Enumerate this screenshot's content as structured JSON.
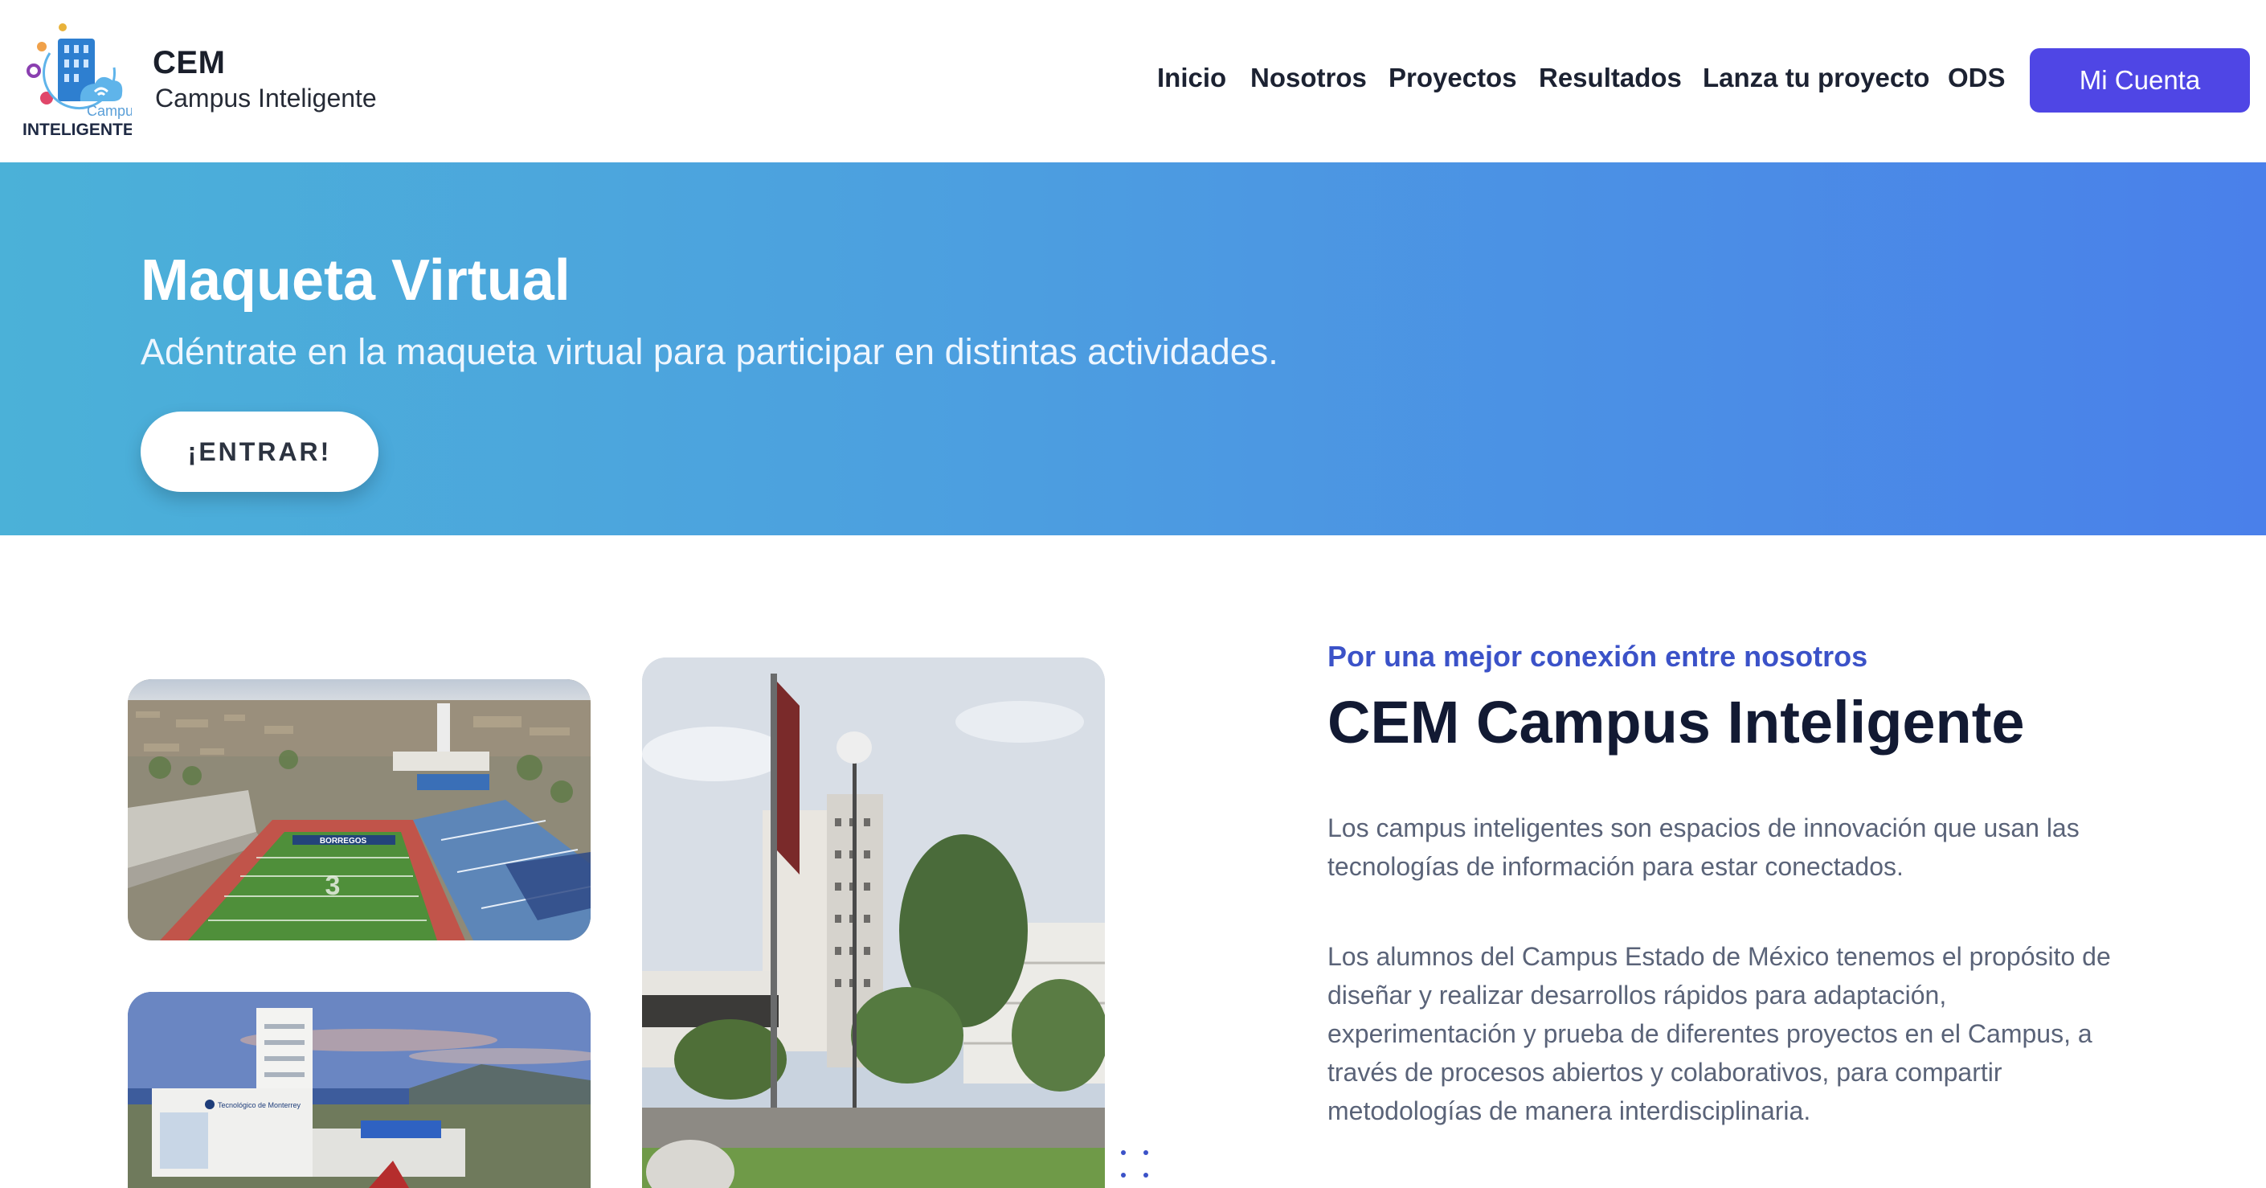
{
  "header": {
    "logo_caption_top": "Campus",
    "logo_caption_bottom": "INTELIGENTE",
    "brand_title": "CEM",
    "brand_subtitle": "Campus Inteligente",
    "nav": [
      {
        "label": "Inicio"
      },
      {
        "label": "Nosotros"
      },
      {
        "label": "Proyectos"
      },
      {
        "label": "Resultados"
      },
      {
        "label": "Lanza tu proyecto"
      },
      {
        "label": "ODS"
      }
    ],
    "account_button": "Mi Cuenta"
  },
  "hero": {
    "title": "Maqueta Virtual",
    "subtitle": "Adéntrate en la maqueta virtual para participar en distintas actividades.",
    "button": "¡ENTRAR!"
  },
  "about": {
    "eyebrow": "Por una mejor conexión entre nosotros",
    "title": "CEM Campus Inteligente",
    "paragraph1": "Los campus inteligentes son espacios de innovación que usan las tecnologías de información para estar conectados.",
    "paragraph2": "Los alumnos del Campus Estado de México tenemos el propósito de diseñar y realizar desarrollos rápidos para adaptación, experimentación y prueba de diferentes proyectos en el Campus, a través de procesos abiertos y colaborativos, para compartir metodologías de manera interdisciplinaria."
  },
  "photos": {
    "stadium_sign": "BORREGOS",
    "stadium_number": "3",
    "building_sign": "Tecnológico de Monterrey"
  },
  "colors": {
    "accent": "#4f46e5",
    "hero_start": "#4bb1d8",
    "hero_end": "#4a80ea",
    "eyebrow": "#3b52c8"
  }
}
